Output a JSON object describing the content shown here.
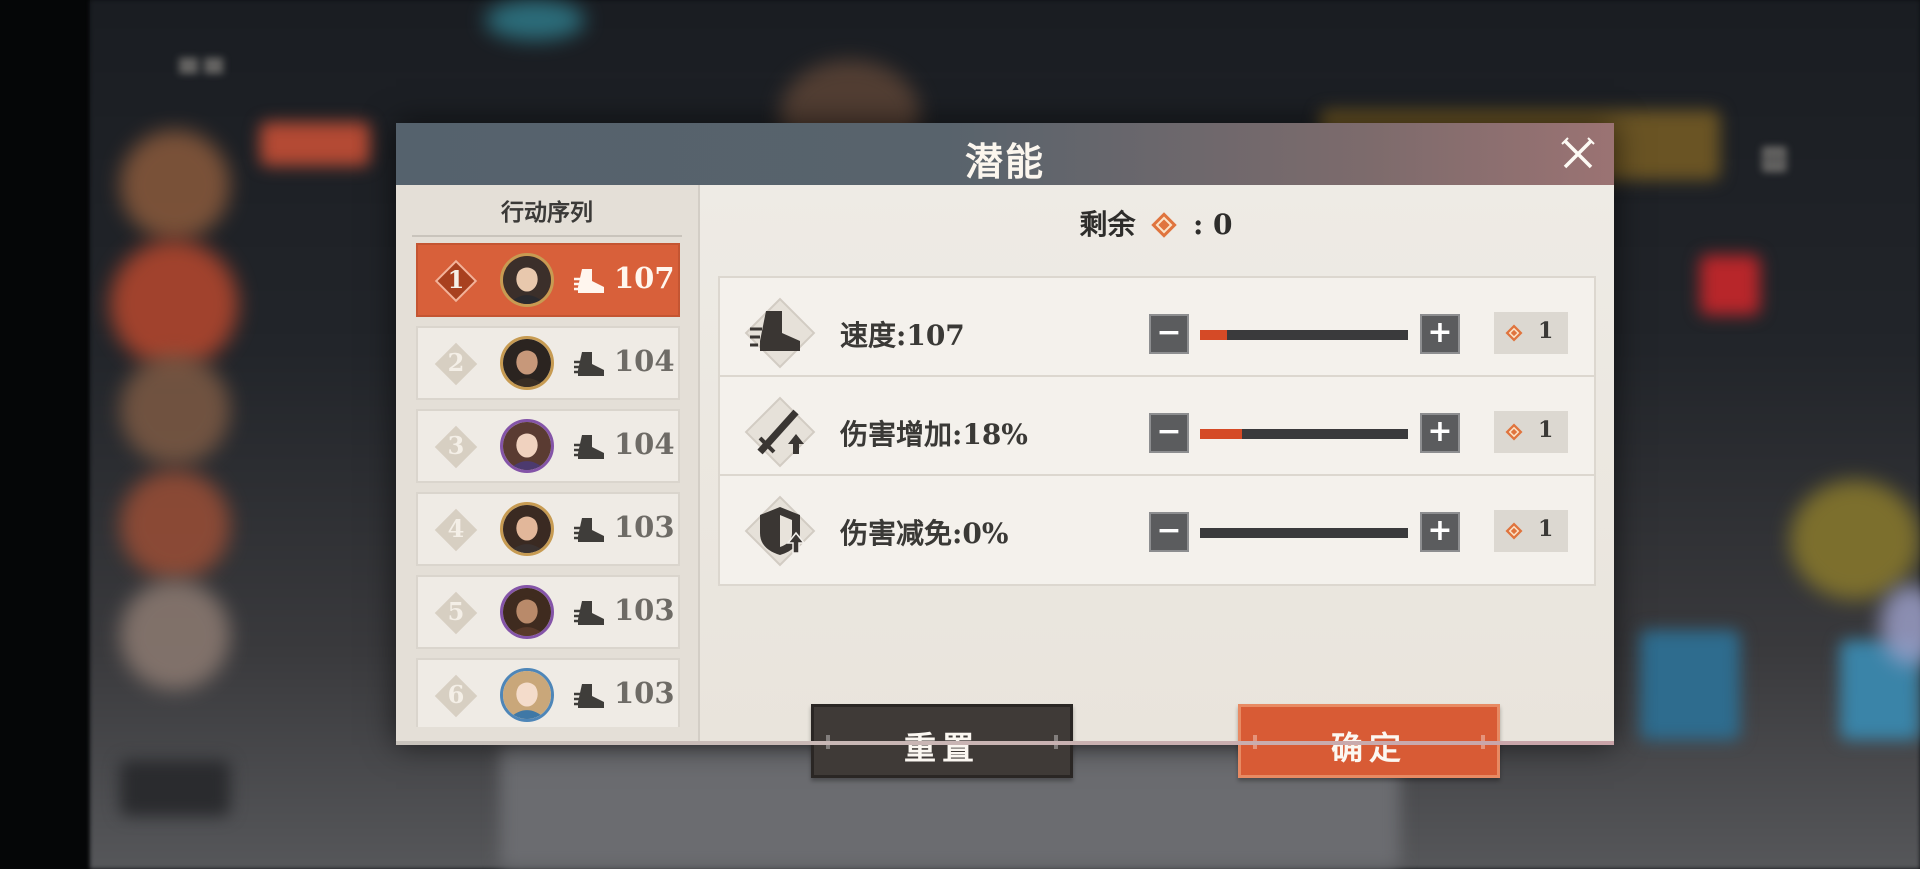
{
  "dialog": {
    "title": "潜能",
    "remaining_label": "剩余",
    "remaining_value": ": 0",
    "remaining_icon": "potential-gem-icon",
    "close_icon": "close-x-icon"
  },
  "sequence": {
    "title": "行动序列",
    "items": [
      {
        "rank": "1",
        "speed": "107",
        "active": true
      },
      {
        "rank": "2",
        "speed": "104",
        "active": false
      },
      {
        "rank": "3",
        "speed": "104",
        "active": false
      },
      {
        "rank": "4",
        "speed": "103",
        "active": false
      },
      {
        "rank": "5",
        "speed": "103",
        "active": false
      },
      {
        "rank": "6",
        "speed": "103",
        "active": false
      }
    ]
  },
  "stats": [
    {
      "icon": "speed-boot-icon",
      "label": "速度:107",
      "fill_fraction": 0.13,
      "cost": "1"
    },
    {
      "icon": "damage-sword-icon",
      "label": "伤害增加:18%",
      "fill_fraction": 0.2,
      "cost": "1"
    },
    {
      "icon": "defense-shield-icon",
      "label": "伤害减免:0%",
      "fill_fraction": 0.0,
      "cost": "1"
    }
  ],
  "controls": {
    "minus": "−",
    "plus": "+"
  },
  "buttons": {
    "reset": "重置",
    "confirm": "确定"
  },
  "colors": {
    "accent": "#d85b35",
    "title_bar": "#55626d",
    "reset_btn": "#3f3a37"
  }
}
